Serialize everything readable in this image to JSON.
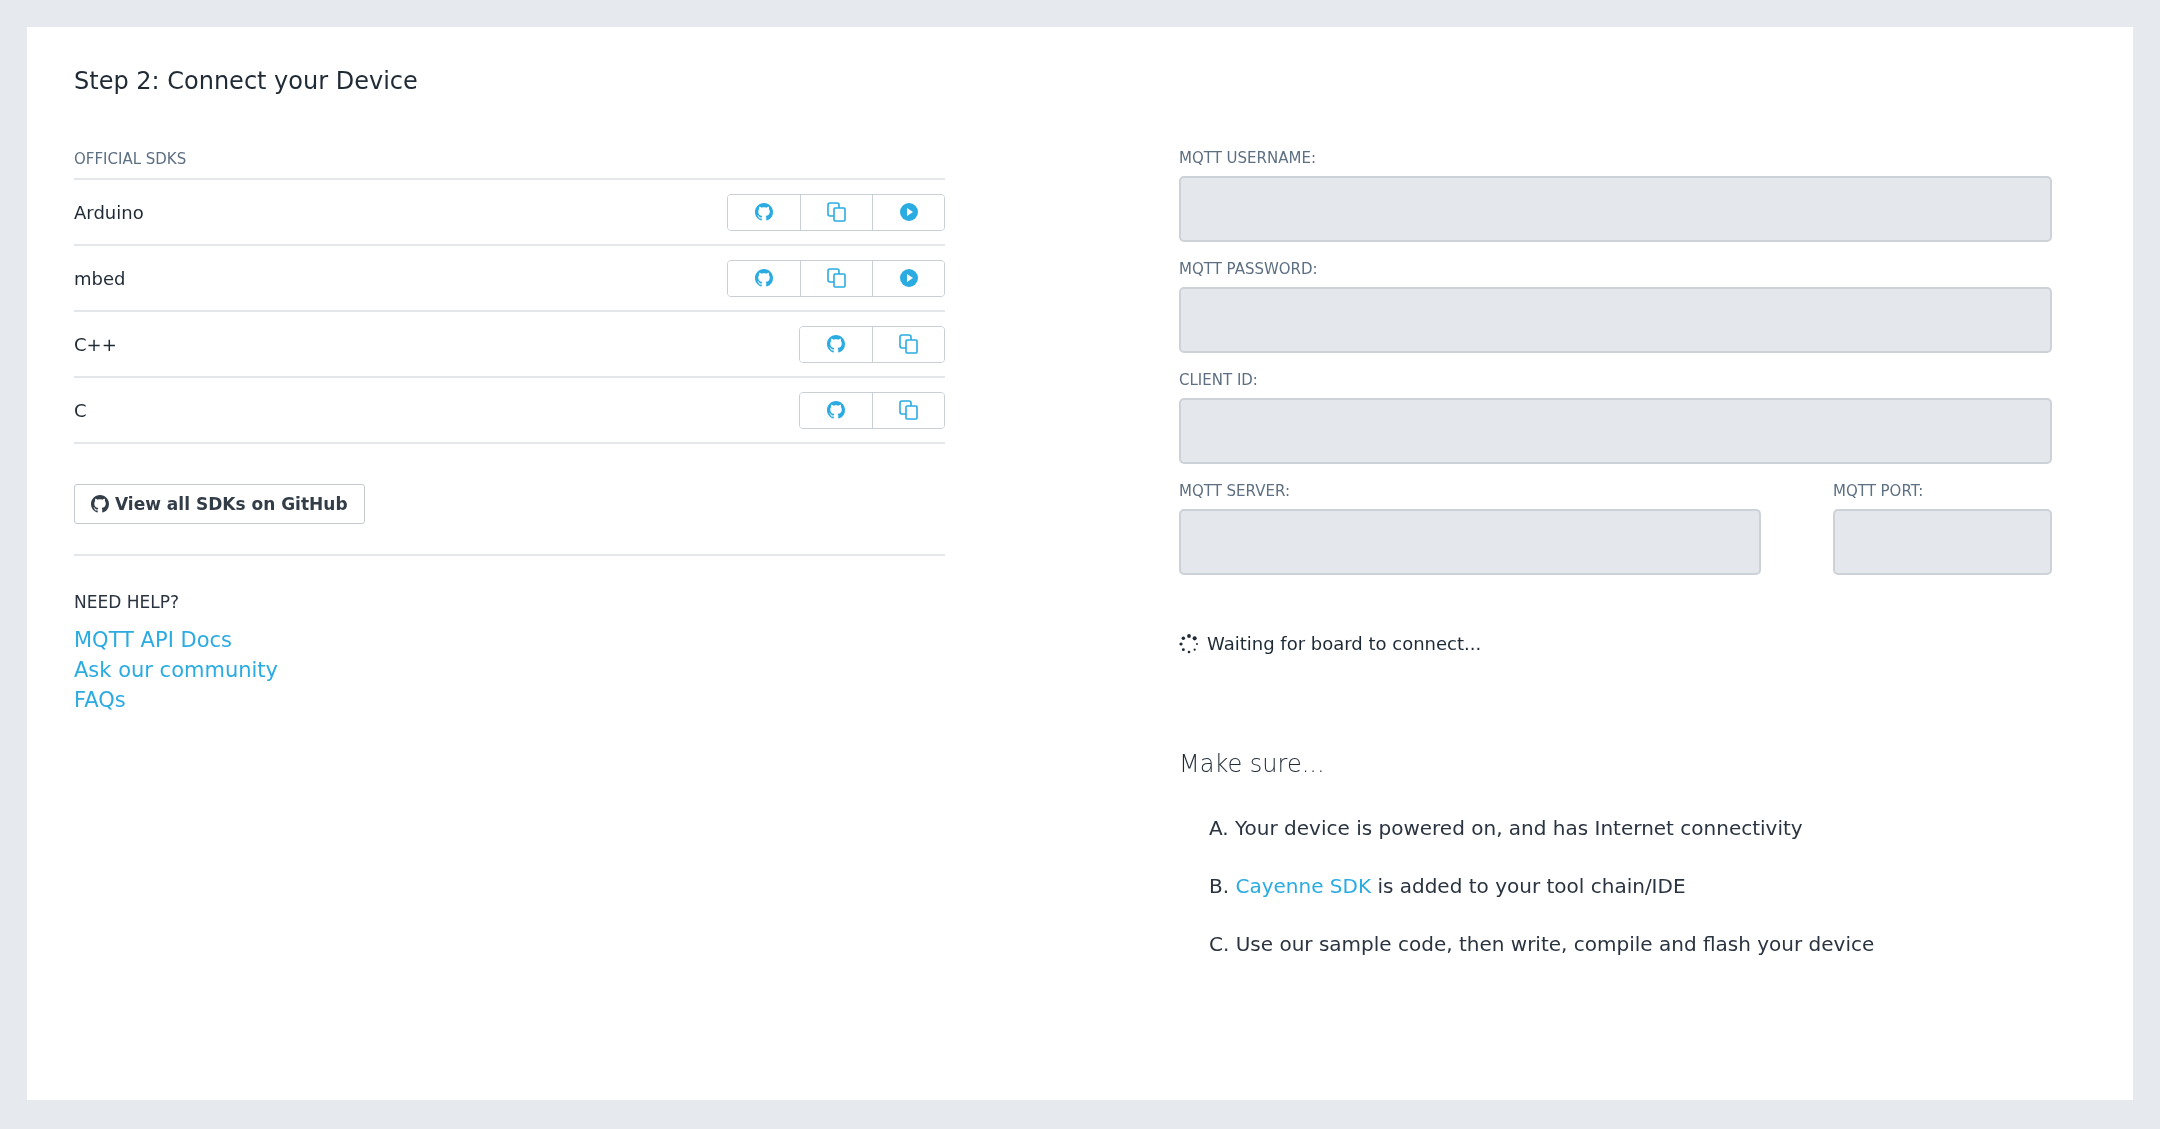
{
  "title": "Step 2: Connect your Device",
  "sdks": {
    "heading": "OFFICIAL SDKS",
    "items": [
      {
        "name": "Arduino",
        "buttons": [
          {
            "kind": "github"
          },
          {
            "kind": "copy"
          },
          {
            "kind": "play"
          }
        ]
      },
      {
        "name": "mbed",
        "buttons": [
          {
            "kind": "github"
          },
          {
            "kind": "copy"
          },
          {
            "kind": "play"
          }
        ]
      },
      {
        "name": "C++",
        "buttons": [
          {
            "kind": "github"
          },
          {
            "kind": "copy"
          }
        ]
      },
      {
        "name": "C",
        "buttons": [
          {
            "kind": "github"
          },
          {
            "kind": "copy"
          }
        ]
      }
    ],
    "github_button": "View all SDKs on GitHub"
  },
  "help": {
    "heading": "NEED HELP?",
    "links": [
      "MQTT API Docs",
      "Ask our community",
      "FAQs"
    ]
  },
  "fields": [
    {
      "label": "MQTT USERNAME:"
    },
    {
      "label": "MQTT PASSWORD:"
    },
    {
      "label": "CLIENT ID:"
    }
  ],
  "server_fields": [
    {
      "label": "MQTT SERVER:"
    },
    {
      "label": "MQTT PORT:"
    }
  ],
  "status": "Waiting for board to connect...",
  "make_sure": {
    "heading": "Make sure...",
    "items": [
      "A. Your device is powered on, and has Internet connectivity",
      {
        "prefix": "B.",
        "link": "Cayenne SDK",
        "rest": "is added to your tool chain/IDE"
      },
      "C. Use our sample code, then write, compile and flash your device"
    ]
  }
}
